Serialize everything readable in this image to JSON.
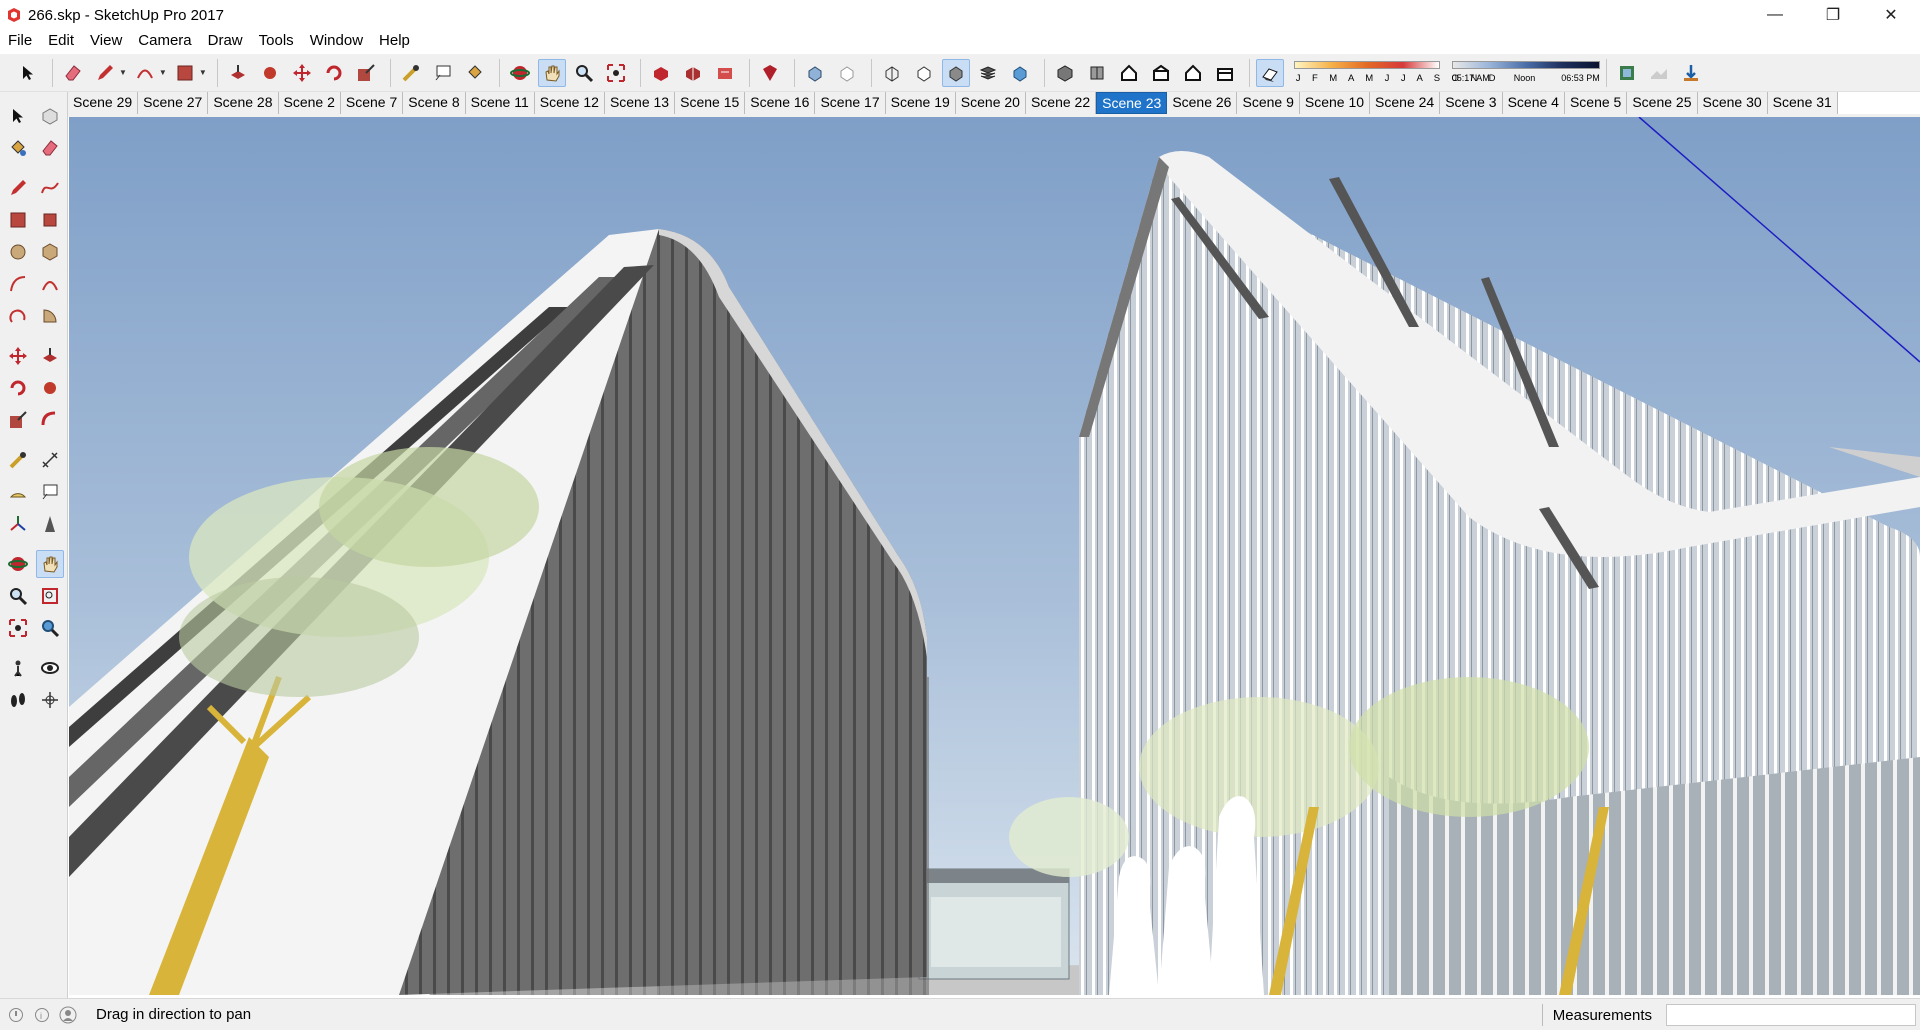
{
  "window": {
    "title": "266.skp - SketchUp Pro 2017",
    "minimize_glyph": "—",
    "restore_glyph": "❐",
    "close_glyph": "✕"
  },
  "menu": {
    "items": [
      "File",
      "Edit",
      "View",
      "Camera",
      "Draw",
      "Tools",
      "Window",
      "Help"
    ]
  },
  "shadow_settings": {
    "months_label": "J F M A M J J A S O N D",
    "time_start": "05:17 AM",
    "time_mid": "Noon",
    "time_end": "06:53 PM"
  },
  "scenes": {
    "active": "Scene 23",
    "tabs": [
      "Scene 29",
      "Scene 27",
      "Scene 28",
      "Scene 2",
      "Scene 7",
      "Scene 8",
      "Scene 11",
      "Scene 12",
      "Scene 13",
      "Scene 15",
      "Scene 16",
      "Scene 17",
      "Scene 19",
      "Scene 20",
      "Scene 22",
      "Scene 23",
      "Scene 26",
      "Scene 9",
      "Scene 10",
      "Scene 24",
      "Scene 3",
      "Scene 4",
      "Scene 5",
      "Scene 25",
      "Scene 30",
      "Scene 31"
    ]
  },
  "statusbar": {
    "hint": "Drag in direction to pan",
    "measurements_label": "Measurements",
    "measurements_value": ""
  },
  "colors": {
    "sky_top": "#7f9fc8",
    "sky_bottom": "#dbe5ef",
    "accent": "#1f74c9",
    "building_white": "#f4f4f4",
    "building_gray": "#6f6f6f"
  }
}
